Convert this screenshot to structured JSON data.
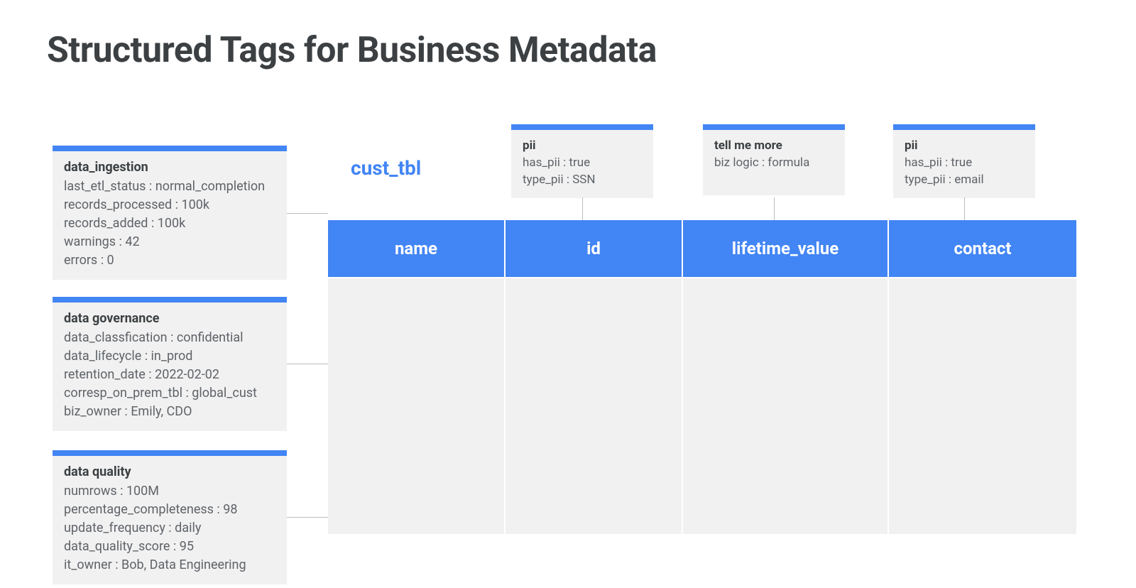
{
  "title": "Structured Tags for Business Metadata",
  "table_name": "cust_tbl",
  "columns": [
    "name",
    "id",
    "lifetime_value",
    "contact"
  ],
  "left_tags": [
    {
      "title": "data_ingestion",
      "rows": [
        "last_etl_status : normal_completion",
        "records_processed : 100k",
        "records_added : 100k",
        "warnings : 42",
        "errors : 0"
      ]
    },
    {
      "title": "data governance",
      "rows": [
        "data_classfication : confidential",
        "data_lifecycle : in_prod",
        "retention_date : 2022-02-02",
        "corresp_on_prem_tbl : global_cust",
        "biz_owner : Emily, CDO"
      ]
    },
    {
      "title": "data quality",
      "rows": [
        "numrows : 100M",
        "percentage_completeness : 98",
        "update_frequency : daily",
        "data_quality_score : 95",
        "it_owner : Bob, Data Engineering"
      ]
    }
  ],
  "top_tags": [
    {
      "title": "pii",
      "rows": [
        "has_pii : true",
        "type_pii : SSN"
      ]
    },
    {
      "title": "tell me more",
      "rows": [
        "biz logic : formula"
      ]
    },
    {
      "title": "pii",
      "rows": [
        "has_pii : true",
        "type_pii : email"
      ]
    }
  ]
}
